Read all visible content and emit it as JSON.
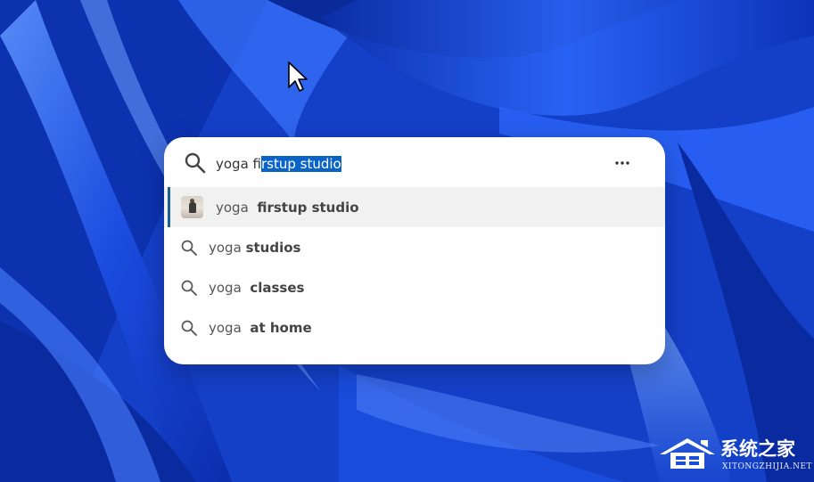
{
  "search": {
    "query_typed": "yoga fi",
    "query_autocomplete": "rstup studio",
    "more_icon": "more-horizontal-icon",
    "search_icon": "search-icon"
  },
  "suggestions": [
    {
      "prefix": "yoga",
      "bold": "firstup studio",
      "icon": "thumbnail-image",
      "active": true
    },
    {
      "prefix": "yoga",
      "bold": "studios",
      "icon": "search-icon",
      "active": false
    },
    {
      "prefix": "yoga",
      "bold": "classes",
      "icon": "search-icon",
      "active": false
    },
    {
      "prefix": "yoga",
      "bold": "at home",
      "icon": "search-icon",
      "active": false
    }
  ],
  "watermark": {
    "title": "系统之家",
    "subtitle": "XITONGZHIJIA.NET"
  },
  "colors": {
    "selection": "#0a64c8",
    "active_indicator": "#1a5f8f",
    "wallpaper_base": "#1e55e8"
  }
}
